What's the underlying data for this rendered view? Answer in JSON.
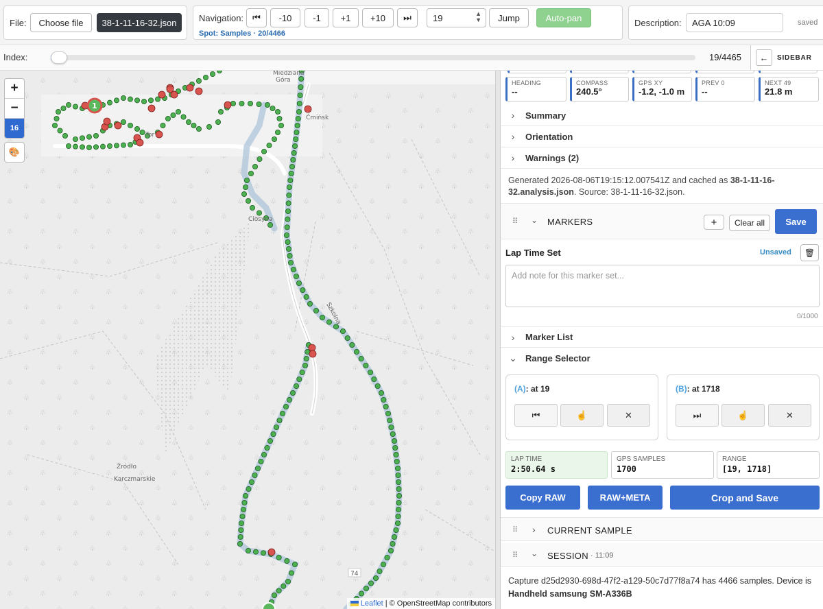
{
  "file": {
    "label": "File:",
    "choose": "Choose file",
    "filename": "38-1-11-16-32.json"
  },
  "nav": {
    "label": "Navigation:",
    "first_icon": "skip-first-icon",
    "m10": "-10",
    "m1": "-1",
    "p1": "+1",
    "p10": "+10",
    "last_icon": "skip-last-icon",
    "jump_value": "19",
    "jump": "Jump",
    "autopan": "Auto-pan",
    "spot": "Spot: Samples · 20/4466"
  },
  "desc": {
    "label": "Description:",
    "value": "AGA 10:09",
    "status": "saved"
  },
  "index": {
    "label": "Index:",
    "value": "19/4465",
    "sidebar": "SIDEBAR",
    "progress": 0.004
  },
  "map": {
    "zoom_in": "+",
    "zoom_out": "−",
    "zoom_level": "16",
    "attribution_leaflet": "Leaflet",
    "attribution_rest": "| © OpenStreetMap contributors",
    "places": [
      "Miedziana Góra",
      "Ćmińsk",
      "Tor",
      "Ciosyna",
      "Szkolna",
      "Źródło Karczmarskie",
      "74",
      "1"
    ]
  },
  "stats": [
    {
      "k": "HEADING",
      "v": "--"
    },
    {
      "k": "COMPASS",
      "v": "240.5°"
    },
    {
      "k": "GPS XY",
      "v": "-1.2, -1.0 m"
    },
    {
      "k": "PREV 0",
      "v": "--"
    },
    {
      "k": "NEXT 49",
      "v": "21.8 m"
    }
  ],
  "sections": {
    "summary": "Summary",
    "orientation": "Orientation",
    "warnings": "Warnings (2)"
  },
  "generated": {
    "pre": "Generated 2026-08-06T19:15:12.007541Z and cached as ",
    "bold": "38-1-11-16-32.analysis.json",
    "post": ". Source: 38-1-11-16-32.json."
  },
  "markers": {
    "title": "MARKERS",
    "add": "+",
    "clear": "Clear all",
    "save": "Save",
    "set_name": "Lap Time Set",
    "unsaved": "Unsaved",
    "note_placeholder": "Add note for this marker set...",
    "count": "0/1000",
    "list": "Marker List",
    "range": "Range Selector"
  },
  "range": {
    "a_label": "(A)",
    "a_text": ": at 19",
    "b_label": "(B)",
    "b_text": ": at 1718",
    "lap_k": "LAP TIME",
    "lap_v": "2:50.64 s",
    "gps_k": "GPS SAMPLES",
    "gps_v": "1700",
    "range_k": "RANGE",
    "range_v": "[19, 1718]",
    "copy_raw": "Copy RAW",
    "raw_meta": "RAW+META",
    "crop": "Crop and Save"
  },
  "current": {
    "title": "CURRENT SAMPLE"
  },
  "session": {
    "title": "SESSION",
    "time": "· 11:09",
    "text_pre": "Capture d25d2930-698d-47f2-a129-50c7d77f8a74 has 4466 samples. Device is ",
    "device": "Handheld samsung SM-A336B"
  },
  "colors": {
    "accent": "#3a6fd0",
    "green": "#5cb85c",
    "red": "#d9534f",
    "track": "#4caf50"
  }
}
